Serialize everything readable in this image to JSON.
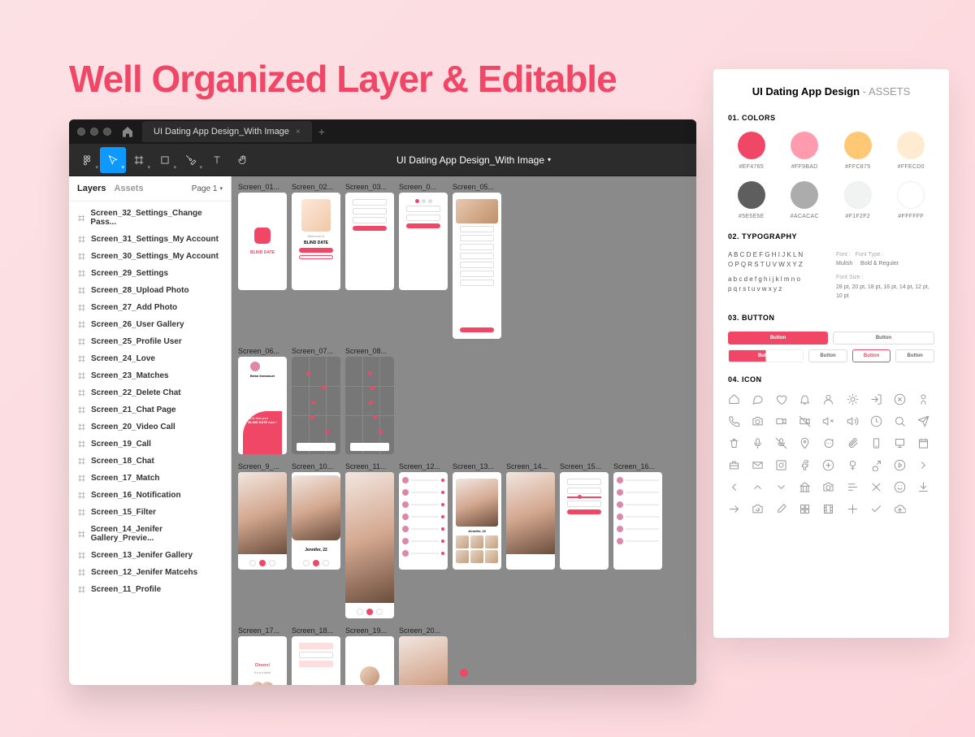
{
  "hero": {
    "title": "Well Organized Layer & Editable"
  },
  "figma": {
    "tab_title": "UI Dating App Design_With Image",
    "canvas_title": "UI Dating App Design_With Image",
    "panel": {
      "layers_tab": "Layers",
      "assets_tab": "Assets",
      "page_label": "Page 1"
    },
    "layers": [
      "Screen_32_Settings_Change Pass...",
      "Screen_31_Settings_My Account",
      "Screen_30_Settings_My Account",
      "Screen_29_Settings",
      "Screen_28_Upload Photo",
      "Screen_27_Add Photo",
      "Screen_26_User Gallery",
      "Screen_25_Profile User",
      "Screen_24_Love",
      "Screen_23_Matches",
      "Screen_22_Delete Chat",
      "Screen_21_Chat Page",
      "Screen_20_Video Call",
      "Screen_19_Call",
      "Screen_18_Chat",
      "Screen_17_Match",
      "Screen_16_Notification",
      "Screen_15_Filter",
      "Screen_14_Jenifer Gallery_Previe...",
      "Screen_13_Jenifer Gallery",
      "Screen_12_Jenifer Matcehs",
      "Screen_11_Profile"
    ],
    "artboard_labels": {
      "r1": [
        "Screen_01...",
        "Screen_02...",
        "Screen_03...",
        "Screen_0...",
        "Screen_05..."
      ],
      "r2": [
        "Screen_06...",
        "Screen_07...",
        "Screen_08..."
      ],
      "r3": [
        "Screen_9_...",
        "Screen_10...",
        "Screen_11...",
        "Screen_12...",
        "Screen_13...",
        "Screen_14...",
        "Screen_15...",
        "Screen_16..."
      ],
      "r4": [
        "Screen_17...",
        "Screen_18...",
        "Screen_19...",
        "Screen_20..."
      ]
    },
    "mock": {
      "app_name": "BLIND DATE",
      "welcome_text": "Let's find your",
      "welcome_bold": "BLIND DATE now !",
      "match_title": "Cheers!",
      "match_sub": "It's a match"
    }
  },
  "assets": {
    "title_bold": "UI Dating App Design",
    "title_light": " - ASSETS",
    "sections": {
      "colors": "01. COLORS",
      "typo": "02. TYPOGRAPHY",
      "button": "03. BUTTON",
      "icon": "04. ICON"
    },
    "colors": [
      {
        "hex": "#EF4765"
      },
      {
        "hex": "#FF9BAD"
      },
      {
        "hex": "#FFC875"
      },
      {
        "hex": "#FFECD0"
      },
      {
        "hex": "#5E5E5E"
      },
      {
        "hex": "#ACACAC"
      },
      {
        "hex": "#F1F2F2"
      },
      {
        "hex": "#FFFFFF"
      }
    ],
    "typo": {
      "sample_upper": "A B C D E F G H I J K L N",
      "sample_upper2": "O P Q R S T U V W X Y Z",
      "sample_lower": "a b c d e f g h i j k l m n o",
      "sample_lower2": "p q r s t u v w x y z",
      "font_label": "Font :",
      "font_value": "Mulish",
      "type_label": "Font  Type :",
      "type_value": "Bold & Reguler",
      "size_label": "Font  Size :",
      "size_value": "28 pt, 20 pt, 18 pt, 16 pt, 14 pt, 12 pt, 10 pt"
    },
    "button_label": "Button"
  }
}
